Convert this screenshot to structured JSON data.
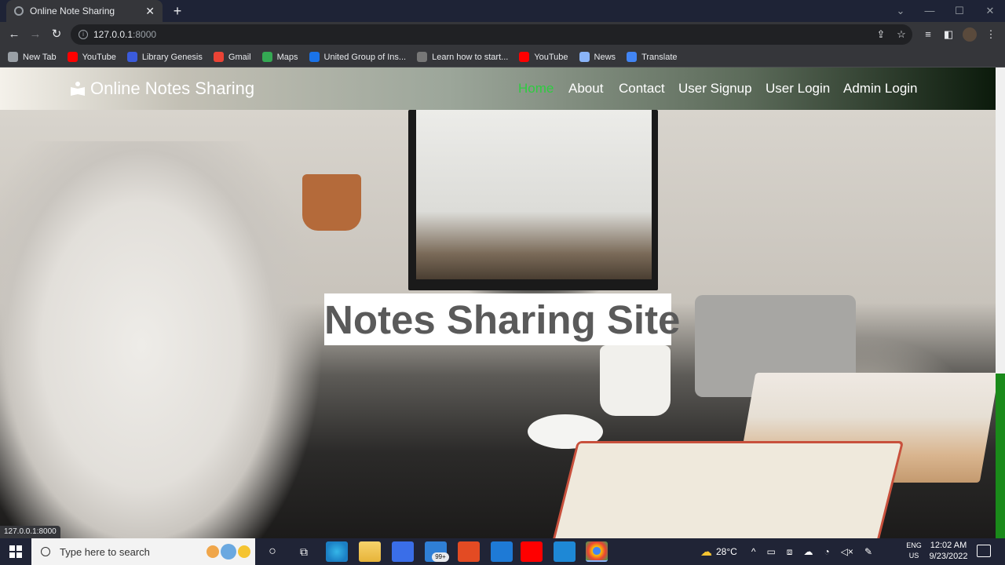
{
  "browser": {
    "tab_title": "Online Note Sharing",
    "url_host": "127.0.0.1",
    "url_port": ":8000",
    "status_url": "127.0.0.1:8000",
    "bookmarks": [
      {
        "label": "New Tab",
        "icon": "globe-icon",
        "color": "#9aa0a6"
      },
      {
        "label": "YouTube",
        "icon": "youtube-icon",
        "color": "#ff0000"
      },
      {
        "label": "Library Genesis",
        "icon": "libgen-icon",
        "color": "#3b5bdb"
      },
      {
        "label": "Gmail",
        "icon": "gmail-icon",
        "color": "#ea4335"
      },
      {
        "label": "Maps",
        "icon": "maps-icon",
        "color": "#34a853"
      },
      {
        "label": "United Group of Ins...",
        "icon": "ugi-icon",
        "color": "#1a73e8"
      },
      {
        "label": "Learn how to start...",
        "icon": "cc-icon",
        "color": "#777"
      },
      {
        "label": "YouTube",
        "icon": "youtube-icon",
        "color": "#ff0000"
      },
      {
        "label": "News",
        "icon": "news-icon",
        "color": "#8ab4f8"
      },
      {
        "label": "Translate",
        "icon": "translate-icon",
        "color": "#4285f4"
      }
    ]
  },
  "site": {
    "brand": "Online Notes Sharing",
    "nav": {
      "home": "Home",
      "about": "About",
      "contact": "Contact",
      "signup": "User Signup",
      "login": "User Login",
      "admin": "Admin Login"
    },
    "hero_title": "Notes Sharing Site"
  },
  "taskbar": {
    "search_placeholder": "Type here to search",
    "mail_badge": "99+",
    "temperature": "28°C",
    "lang_top": "ENG",
    "lang_bottom": "US",
    "time": "12:02 AM",
    "date": "9/23/2022"
  }
}
